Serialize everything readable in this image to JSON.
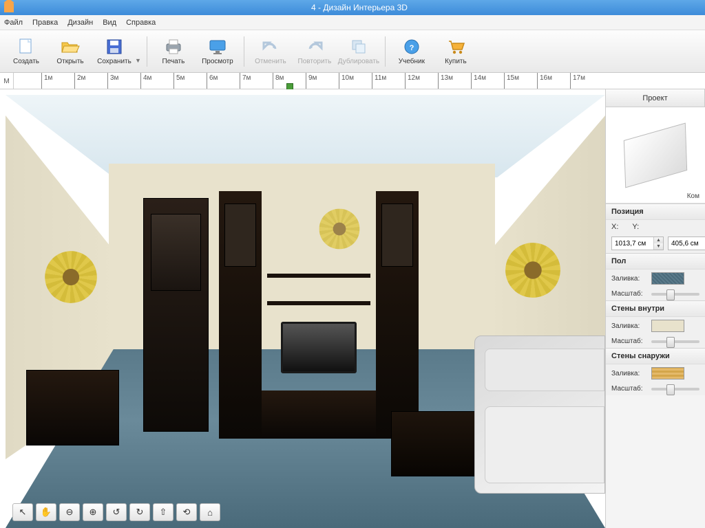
{
  "window": {
    "title": "4 - Дизайн Интерьера 3D"
  },
  "menu": {
    "file": "Файл",
    "edit": "Правка",
    "design": "Дизайн",
    "view": "Вид",
    "help": "Справка"
  },
  "toolbar": {
    "create": "Создать",
    "open": "Открыть",
    "save": "Сохранить",
    "print": "Печать",
    "preview": "Просмотр",
    "undo": "Отменить",
    "redo": "Повторить",
    "duplicate": "Дублировать",
    "tutorial": "Учебник",
    "buy": "Купить"
  },
  "ruler": {
    "unit": "М",
    "ticks": [
      "1м",
      "2м",
      "3м",
      "4м",
      "5м",
      "6м",
      "7м",
      "8м",
      "9м",
      "10м",
      "11м",
      "12м",
      "13м",
      "14м",
      "15м",
      "16м",
      "17м"
    ]
  },
  "side": {
    "tab_project": "Проект",
    "preview_caption": "Ком",
    "position": {
      "title": "Позиция",
      "x_label": "X:",
      "y_label": "Y:",
      "x": "1013,7 см",
      "y": "405,6 см"
    },
    "floor": {
      "title": "Пол",
      "fill": "Заливка:",
      "scale": "Масштаб:"
    },
    "walls_in": {
      "title": "Стены внутри",
      "fill": "Заливка:",
      "scale": "Масштаб:"
    },
    "walls_out": {
      "title": "Стены снаружи",
      "fill": "Заливка:",
      "scale": "Масштаб:"
    }
  },
  "viewtools": {
    "pointer": "↖",
    "pan": "✋",
    "zoom_out": "⊖",
    "zoom_in": "⊕",
    "orbit_l": "↺",
    "orbit_r": "↻",
    "walk_fwd": "⇧",
    "walk_turn": "⟲",
    "home": "⌂"
  }
}
